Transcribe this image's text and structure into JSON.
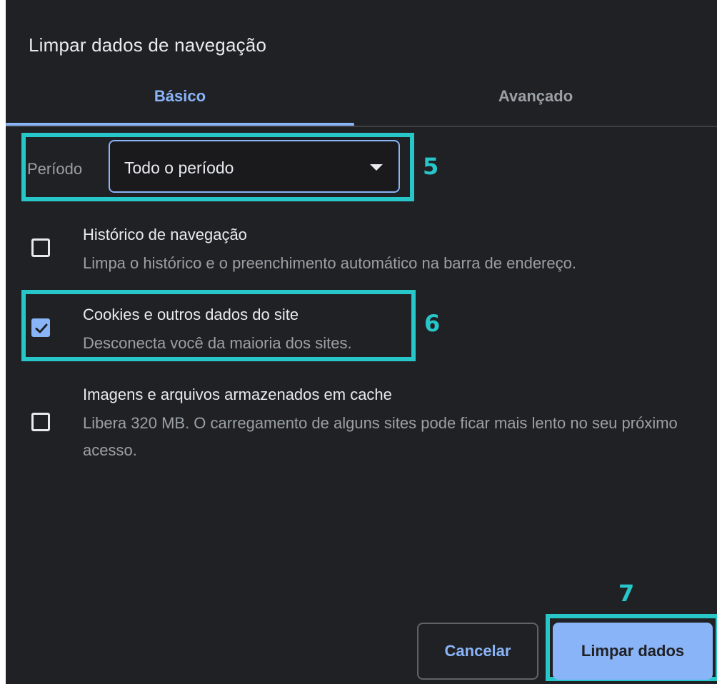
{
  "dialog": {
    "title": "Limpar dados de navegação",
    "tabs": [
      {
        "label": "Básico",
        "active": true
      },
      {
        "label": "Avançado",
        "active": false
      }
    ],
    "period": {
      "label": "Período",
      "value": "Todo o período"
    },
    "options": [
      {
        "title": "Histórico de navegação",
        "description": "Limpa o histórico e o preenchimento automático na barra de endereço.",
        "checked": false
      },
      {
        "title": "Cookies e outros dados do site",
        "description": "Desconecta você da maioria dos sites.",
        "checked": true
      },
      {
        "title": "Imagens e arquivos armazenados em cache",
        "description": "Libera 320 MB. O carregamento de alguns sites pode ficar mais lento no seu próximo acesso.",
        "checked": false
      }
    ],
    "buttons": {
      "cancel": "Cancelar",
      "clear": "Limpar dados"
    }
  },
  "annotations": {
    "step5": "5",
    "step6": "6",
    "step7": "7"
  },
  "colors": {
    "background": "#202124",
    "accent": "#8ab4f8",
    "annotation": "#27c6c9"
  }
}
